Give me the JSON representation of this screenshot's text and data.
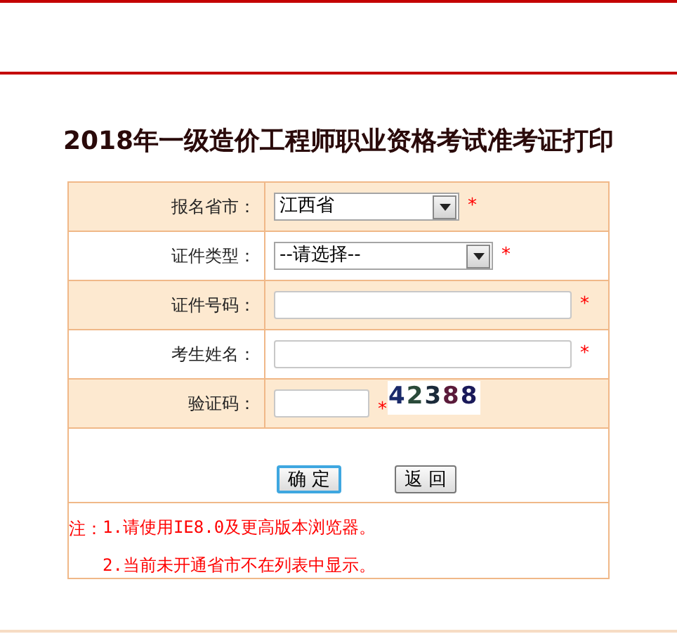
{
  "title": "2018年一级造价工程师职业资格考试准考证打印",
  "form": {
    "rows": [
      {
        "label": "报名省市：",
        "kind": "select",
        "value": "江西省",
        "required_mark": "*"
      },
      {
        "label": "证件类型：",
        "kind": "select",
        "value": "--请选择--",
        "required_mark": "*"
      },
      {
        "label": "证件号码：",
        "kind": "input",
        "required_mark": "*"
      },
      {
        "label": "考生姓名：",
        "kind": "input",
        "required_mark": "*"
      },
      {
        "label": "验证码：",
        "kind": "captcha",
        "required_mark": "*",
        "code": "42388"
      }
    ],
    "buttons": [
      {
        "label": "确 定",
        "focused": true
      },
      {
        "label": "返 回",
        "focused": false
      }
    ]
  },
  "notes": {
    "prefix": "注：",
    "items": [
      "1.请使用IE8.0及更高版本浏览器。",
      "2.当前未开通省市不在列表中显示。"
    ]
  }
}
